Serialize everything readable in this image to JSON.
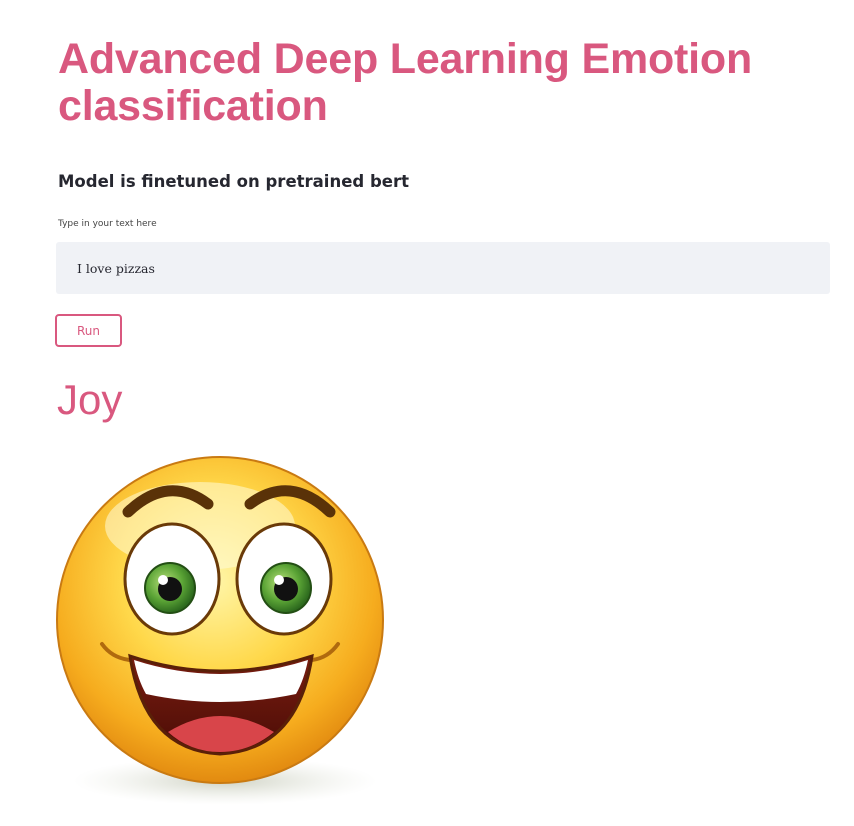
{
  "header": {
    "title": "Advanced Deep Learning Emotion classification"
  },
  "subtitle": "Model is finetuned on pretrained bert",
  "input": {
    "label": "Type in your text here",
    "value": "I love pizzas"
  },
  "run_button": {
    "label": "Run"
  },
  "result": {
    "emotion": "Joy",
    "image_icon": "smiling-face-emoji"
  },
  "colors": {
    "accent": "#d9587f",
    "input_background": "#f0f2f6",
    "text": "#262730"
  }
}
